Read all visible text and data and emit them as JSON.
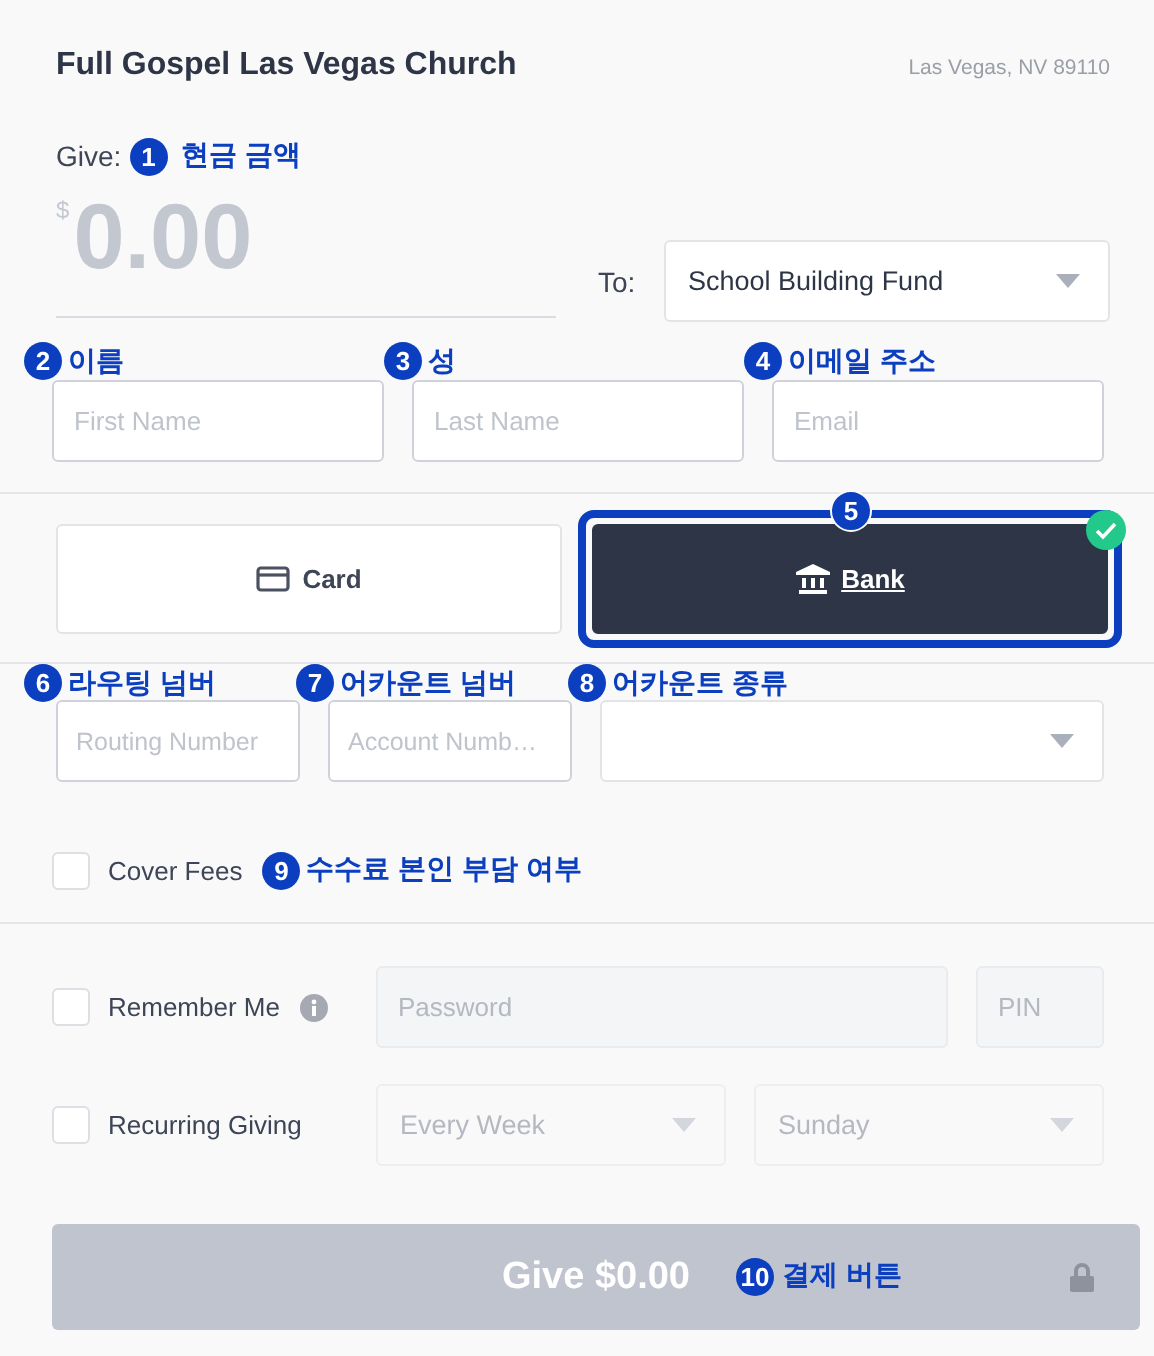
{
  "header": {
    "title": "Full Gospel Las Vegas Church",
    "location": "Las Vegas, NV 89110"
  },
  "amount": {
    "label": "Give:",
    "currency": "$",
    "placeholder": "0.00",
    "note": {
      "number": "1",
      "text": "현금 금액"
    }
  },
  "fund": {
    "label": "To:",
    "value": "School Building Fund"
  },
  "name_fields": [
    {
      "placeholder": "First Name",
      "note": {
        "number": "2",
        "text": "이름"
      }
    },
    {
      "placeholder": "Last Name",
      "note": {
        "number": "3",
        "text": "성"
      }
    },
    {
      "placeholder": "Email",
      "note": {
        "number": "4",
        "text": "이메일 주소"
      }
    }
  ],
  "payment_methods": [
    {
      "kind": "card",
      "label": "Card",
      "selected": false
    },
    {
      "kind": "bank",
      "label": "Bank",
      "selected": true,
      "note": {
        "number": "5"
      }
    }
  ],
  "bank_fields": [
    {
      "kind": "input",
      "placeholder": "Routing Number",
      "note": {
        "number": "6",
        "text": "라우팅 넘버"
      }
    },
    {
      "kind": "input",
      "placeholder": "Account Numb…",
      "note": {
        "number": "7",
        "text": "어카운트 넘버"
      }
    },
    {
      "kind": "select",
      "note": {
        "number": "8",
        "text": "어카운트 종류"
      }
    }
  ],
  "cover_fees": {
    "label": "Cover Fees",
    "checked": false,
    "note": {
      "number": "9",
      "text": "수수료 본인 부담 여부"
    }
  },
  "remember": {
    "label": "Remember Me",
    "checked": false,
    "fields": [
      {
        "placeholder": "Password",
        "disabled": true
      },
      {
        "placeholder": "PIN",
        "disabled": true
      }
    ]
  },
  "recurring": {
    "label": "Recurring Giving",
    "checked": false,
    "selects": [
      {
        "value": "Every Week",
        "disabled": true
      },
      {
        "value": "Sunday",
        "disabled": true
      }
    ]
  },
  "submit": {
    "label": "Give $0.00",
    "disabled": true,
    "note": {
      "number": "10",
      "text": "결제 버튼"
    }
  }
}
